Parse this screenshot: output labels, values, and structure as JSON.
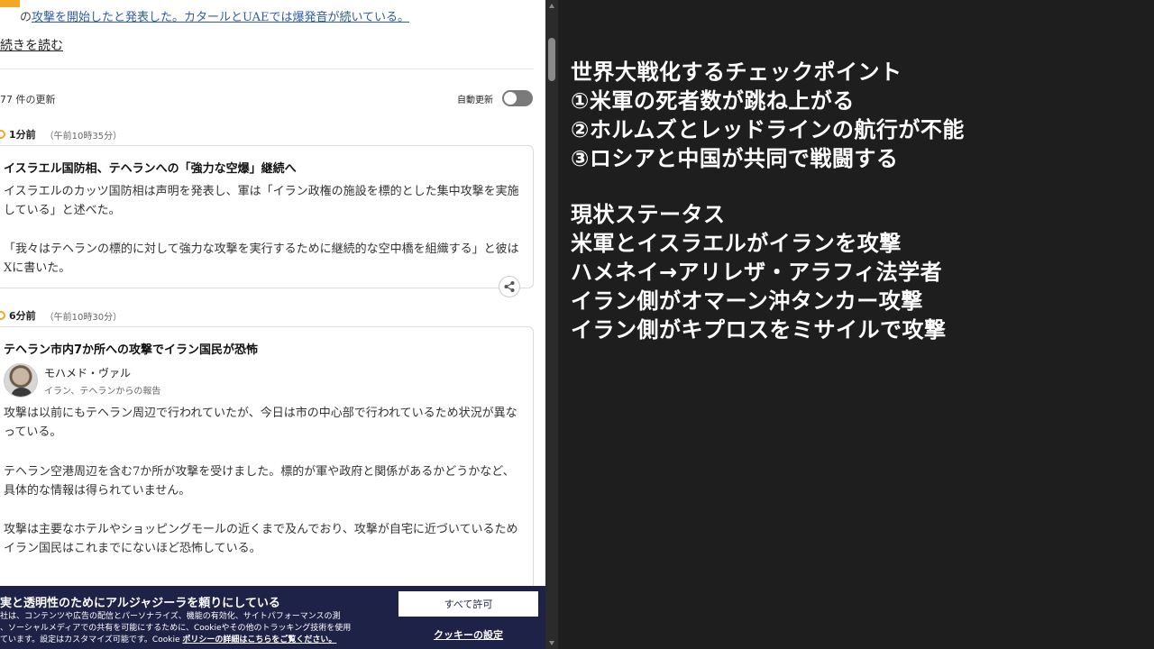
{
  "article": {
    "top_text_prefix": "の",
    "top_link_text": "攻撃を開始したと発表した。カタールとUAEでは爆発音が続いている。",
    "read_more": "続きを読む",
    "update_count": "77 件の更新",
    "auto_update_label": "自動更新"
  },
  "posts": [
    {
      "ago": "1分前",
      "clock": "（午前10時35分）",
      "title": "イスラエル国防相、テヘランへの「強力な空爆」継続へ",
      "paragraphs": [
        "イスラエルのカッツ国防相は声明を発表し、軍は「イラン政権の施設を標的とした集中攻撃を実施している」と述べた。",
        "「我々はテヘランの標的に対して強力な攻撃を実行するために継続的な空中橋を組織する」と彼はXに書いた。"
      ]
    },
    {
      "ago": "6分前",
      "clock": "（午前10時30分）",
      "title": "テヘラン市内7か所への攻撃でイラン国民が恐怖",
      "author": "モハメド・ヴァル",
      "author_sub": "イラン、テヘランからの報告",
      "paragraphs": [
        "攻撃は以前にもテヘラン周辺で行われていたが、今日は市の中心部で行われているため状況が異なっている。",
        "テヘラン空港周辺を含む7か所が攻撃を受けました。標的が軍や政府と関係があるかどうかなど、具体的な情報は得られていません。",
        "攻撃は主要なホテルやショッピングモールの近くまで及んでおり、攻撃が自宅に近づいているためイラン国民はこれまでにないほど恐怖している。"
      ]
    }
  ],
  "cookie": {
    "title": "実と透明性のためにアルジャジーラを頼りにしている",
    "body_1": "社は、コンテンツや広告の配信とパーソナライズ、機能の有効化、サイトパフォーマンスの測",
    "body_2": "、ソーシャルメディアでの共有を可能にするために、Cookieやその他のトラッキング技術を使用",
    "body_3": "ています。設定はカスタマイズ可能です。Cookie",
    "policy_link": "ポリシーの詳細はこちらをご覧ください。",
    "allow_all": "すべて許可",
    "settings": "クッキーの設定"
  },
  "notes": {
    "lines": [
      "世界大戦化するチェックポイント",
      "①米軍の死者数が跳ね上がる",
      "②ホルムズとレッドラインの航行が不能",
      "③ロシアと中国が共同で戦闘する",
      "",
      "現状ステータス",
      "米軍とイスラエルがイランを攻撃",
      "ハメネイ→アリレザ・アラフィ法学者",
      "イラン側がオマーン沖タンカー攻撃",
      "イラン側がキプロスをミサイルで攻撃"
    ]
  },
  "colors": {
    "accent_orange": "#f5a623",
    "link_blue": "#2f5d9e",
    "cookie_bg": "#1f2247",
    "notes_bg": "#1e1e1e"
  }
}
